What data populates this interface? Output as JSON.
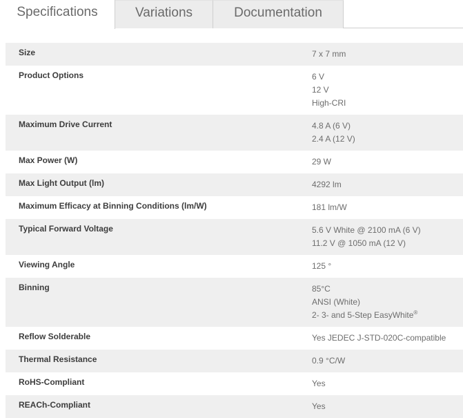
{
  "tabs": [
    {
      "label": "Specifications",
      "active": true
    },
    {
      "label": "Variations",
      "active": false
    },
    {
      "label": "Documentation",
      "active": false
    }
  ],
  "specs": [
    {
      "label": "Size",
      "values": [
        "7 x 7 mm"
      ]
    },
    {
      "label": "Product Options",
      "values": [
        "6 V",
        "12 V",
        "High-CRI"
      ]
    },
    {
      "label": "Maximum Drive Current",
      "values": [
        "4.8 A (6 V)",
        "2.4 A (12 V)"
      ]
    },
    {
      "label": "Max Power (W)",
      "values": [
        "29 W"
      ]
    },
    {
      "label": "Max Light Output (lm)",
      "values": [
        "4292 lm"
      ]
    },
    {
      "label": "Maximum Efficacy at Binning Conditions (lm/W)",
      "values": [
        "181 lm/W"
      ]
    },
    {
      "label": "Typical Forward Voltage",
      "values": [
        "5.6 V White @ 2100 mA (6 V)",
        "11.2 V @ 1050 mA (12 V)"
      ]
    },
    {
      "label": "Viewing Angle",
      "values": [
        "125 °"
      ]
    },
    {
      "label": "Binning",
      "values": [
        "85°C",
        "ANSI (White)",
        "2- 3- and 5-Step EasyWhite"
      ],
      "registered_mark": "®"
    },
    {
      "label": "Reflow Solderable",
      "values": [
        "Yes JEDEC J-STD-020C-compatible"
      ]
    },
    {
      "label": "Thermal Resistance",
      "values": [
        "0.9 °C/W"
      ]
    },
    {
      "label": "RoHS-Compliant",
      "values": [
        "Yes"
      ]
    },
    {
      "label": "REACh-Compliant",
      "values": [
        "Yes"
      ]
    }
  ]
}
